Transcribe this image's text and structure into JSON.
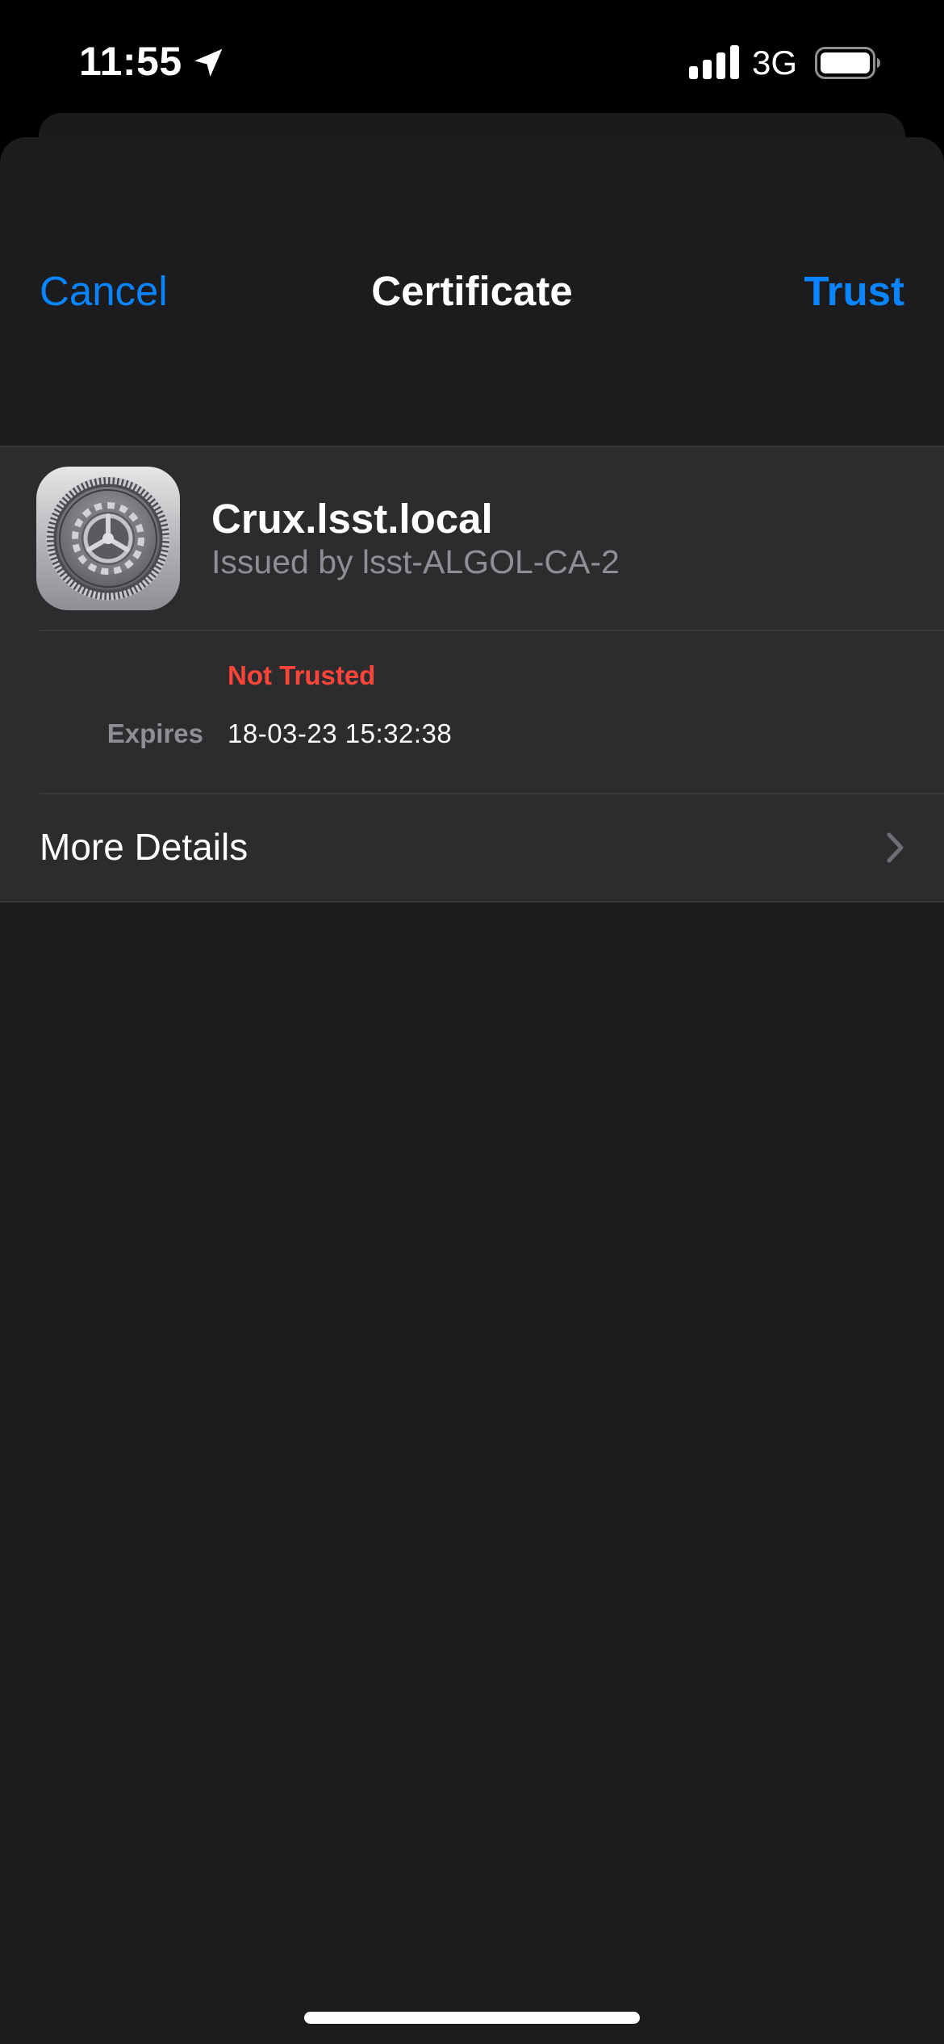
{
  "status_bar": {
    "time": "11:55",
    "network": "3G",
    "icons": [
      "location-arrow-icon",
      "cellular-signal-icon",
      "battery-icon"
    ]
  },
  "nav": {
    "cancel_label": "Cancel",
    "title": "Certificate",
    "trust_label": "Trust"
  },
  "certificate": {
    "icon": "settings-gear-icon",
    "name": "Crux.lsst.local",
    "issuer": "Issued by lsst-ALGOL-CA-2",
    "trust_status": "Not Trusted",
    "expires_label": "Expires",
    "expires_value": "18-03-23 15:32:38"
  },
  "more_details": {
    "label": "More Details",
    "icon": "chevron-right-icon"
  },
  "colors": {
    "accent": "#0a84ff",
    "warning": "#ff453a",
    "sheet_background": "#1c1c1e",
    "group_background": "#2c2c2e",
    "secondary_text": "#8e8e93"
  }
}
